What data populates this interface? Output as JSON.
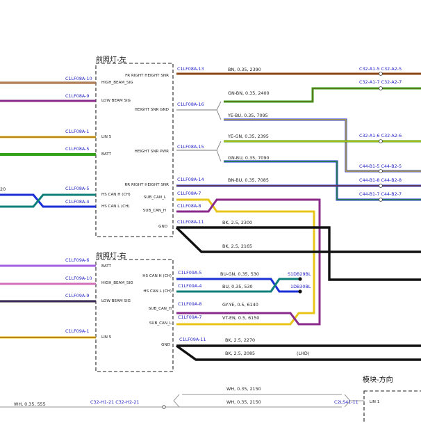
{
  "modules": {
    "left_headlamp": {
      "title": "前照灯-左",
      "pins_left": [
        {
          "code": "C1LF08A-10",
          "signal": "HIGH_BEAM_SIG"
        },
        {
          "code": "C1LF08A-9",
          "signal": "LOW BEAM SIG"
        },
        {
          "code": "C1LF08A-1",
          "signal": "LIN 5"
        },
        {
          "code": "C1LF08A-5",
          "signal": "BATT"
        },
        {
          "code": "C1LF08A-5",
          "signal": "HS CAN H (CH)"
        },
        {
          "code": "C1LF08A-4",
          "signal": "HS CAN L (CH)"
        }
      ],
      "pins_right": [
        {
          "code": "C1LF08A-13",
          "signal": "FR RIGHT HEIGHT SNR"
        },
        {
          "code": "C1LF08A-16",
          "signal": "HEIGHT SNR GND"
        },
        {
          "code": "C1LF08A-15",
          "signal": "HEIGHT SNR PWR"
        },
        {
          "code": "C1LF08A-14",
          "signal": "RR RIGHT HEIGHT SNR"
        },
        {
          "code": "C1LF08A-7",
          "signal": "SUB_CAN_L"
        },
        {
          "code": "C1LF08A-8",
          "signal": "SUB_CAN_H"
        },
        {
          "code": "C1LF08A-11",
          "signal": "GND"
        }
      ]
    },
    "right_headlamp": {
      "title": "前照灯-右",
      "pins_left": [
        {
          "code": "C1LF09A-6",
          "signal": "BATT"
        },
        {
          "code": "C1LF09A-10",
          "signal": "HIGH_BEAM_SIG"
        },
        {
          "code": "C1LF09A-9",
          "signal": "LOW BEAM SIG"
        },
        {
          "code": "C1LF09A-1",
          "signal": "LIN 5"
        }
      ],
      "pins_right": [
        {
          "code": "C1LF09A-5",
          "signal": "HS CAN H (CH)"
        },
        {
          "code": "C1LF09A-4",
          "signal": "HS CAN L (CH)"
        },
        {
          "code": "C1LF09A-8",
          "signal": "SUB_CAN_H"
        },
        {
          "code": "C1LF09A-7",
          "signal": "SUB_CAN_L"
        },
        {
          "code": "C1LF09A-11",
          "signal": "GND"
        }
      ]
    },
    "steering_module": {
      "title": "模块-方向",
      "pin_code": "C2LS41-11",
      "pin_signal": "LIN 1"
    }
  },
  "wires": [
    {
      "text": "BN, 0.35, 2390"
    },
    {
      "text": "GN-BN, 0.35, 2400"
    },
    {
      "text": "YE-BU, 0.35, 7095"
    },
    {
      "text": "YE-GN, 0.35, 2395"
    },
    {
      "text": "GN-BU, 0.35, 7090"
    },
    {
      "text": "BN-BU, 0.35, 7085"
    },
    {
      "text": "BK, 2.5, 2300"
    },
    {
      "text": "BK, 2.5, 2165"
    },
    {
      "text": "BU-GN, 0.35, 530"
    },
    {
      "text": "BU, 0.35, 530"
    },
    {
      "text": "GY-YE, 0.5, 6140"
    },
    {
      "text": "VT-EN, 0.5, 6150"
    },
    {
      "text": "BK, 2.5, 2270"
    },
    {
      "text": "BK, 2.5, 2085"
    },
    {
      "text": "WH, 0.35, 2150"
    },
    {
      "text": "WH, 0.35, 2150"
    },
    {
      "text": "WH, 0.35, 555"
    }
  ],
  "right_connectors": [
    {
      "text": "C32-A1-5  C32-A2-5"
    },
    {
      "text": "C32-A1-7  C32-A2-7"
    },
    {
      "text": "C32-A1-6  C32-A2-6"
    },
    {
      "text": "C44-B1-5  C44-B2-5"
    },
    {
      "text": "C44-B1-8  C44-B2-8"
    },
    {
      "text": "C44-B1-7  C44-B2-7"
    }
  ],
  "splices": {
    "top": "S1DB29BL",
    "bottom": "1DB30BL"
  },
  "misc": {
    "lhd_note": "(LHD)",
    "bottom_connector": "C32-H1-21  C32-H2-21",
    "edge_fragment": "20"
  },
  "colors": {
    "brown": "#8b4513",
    "green": "#33a11a",
    "yellow": "#e8c51a",
    "purple": "#8a2a8a",
    "pink": "#d070b8",
    "blue": "#1a2fd6",
    "teal": "#0f7f7a",
    "black": "#111111",
    "grey": "#6e6e6e",
    "pin_text": "#2323c8"
  }
}
